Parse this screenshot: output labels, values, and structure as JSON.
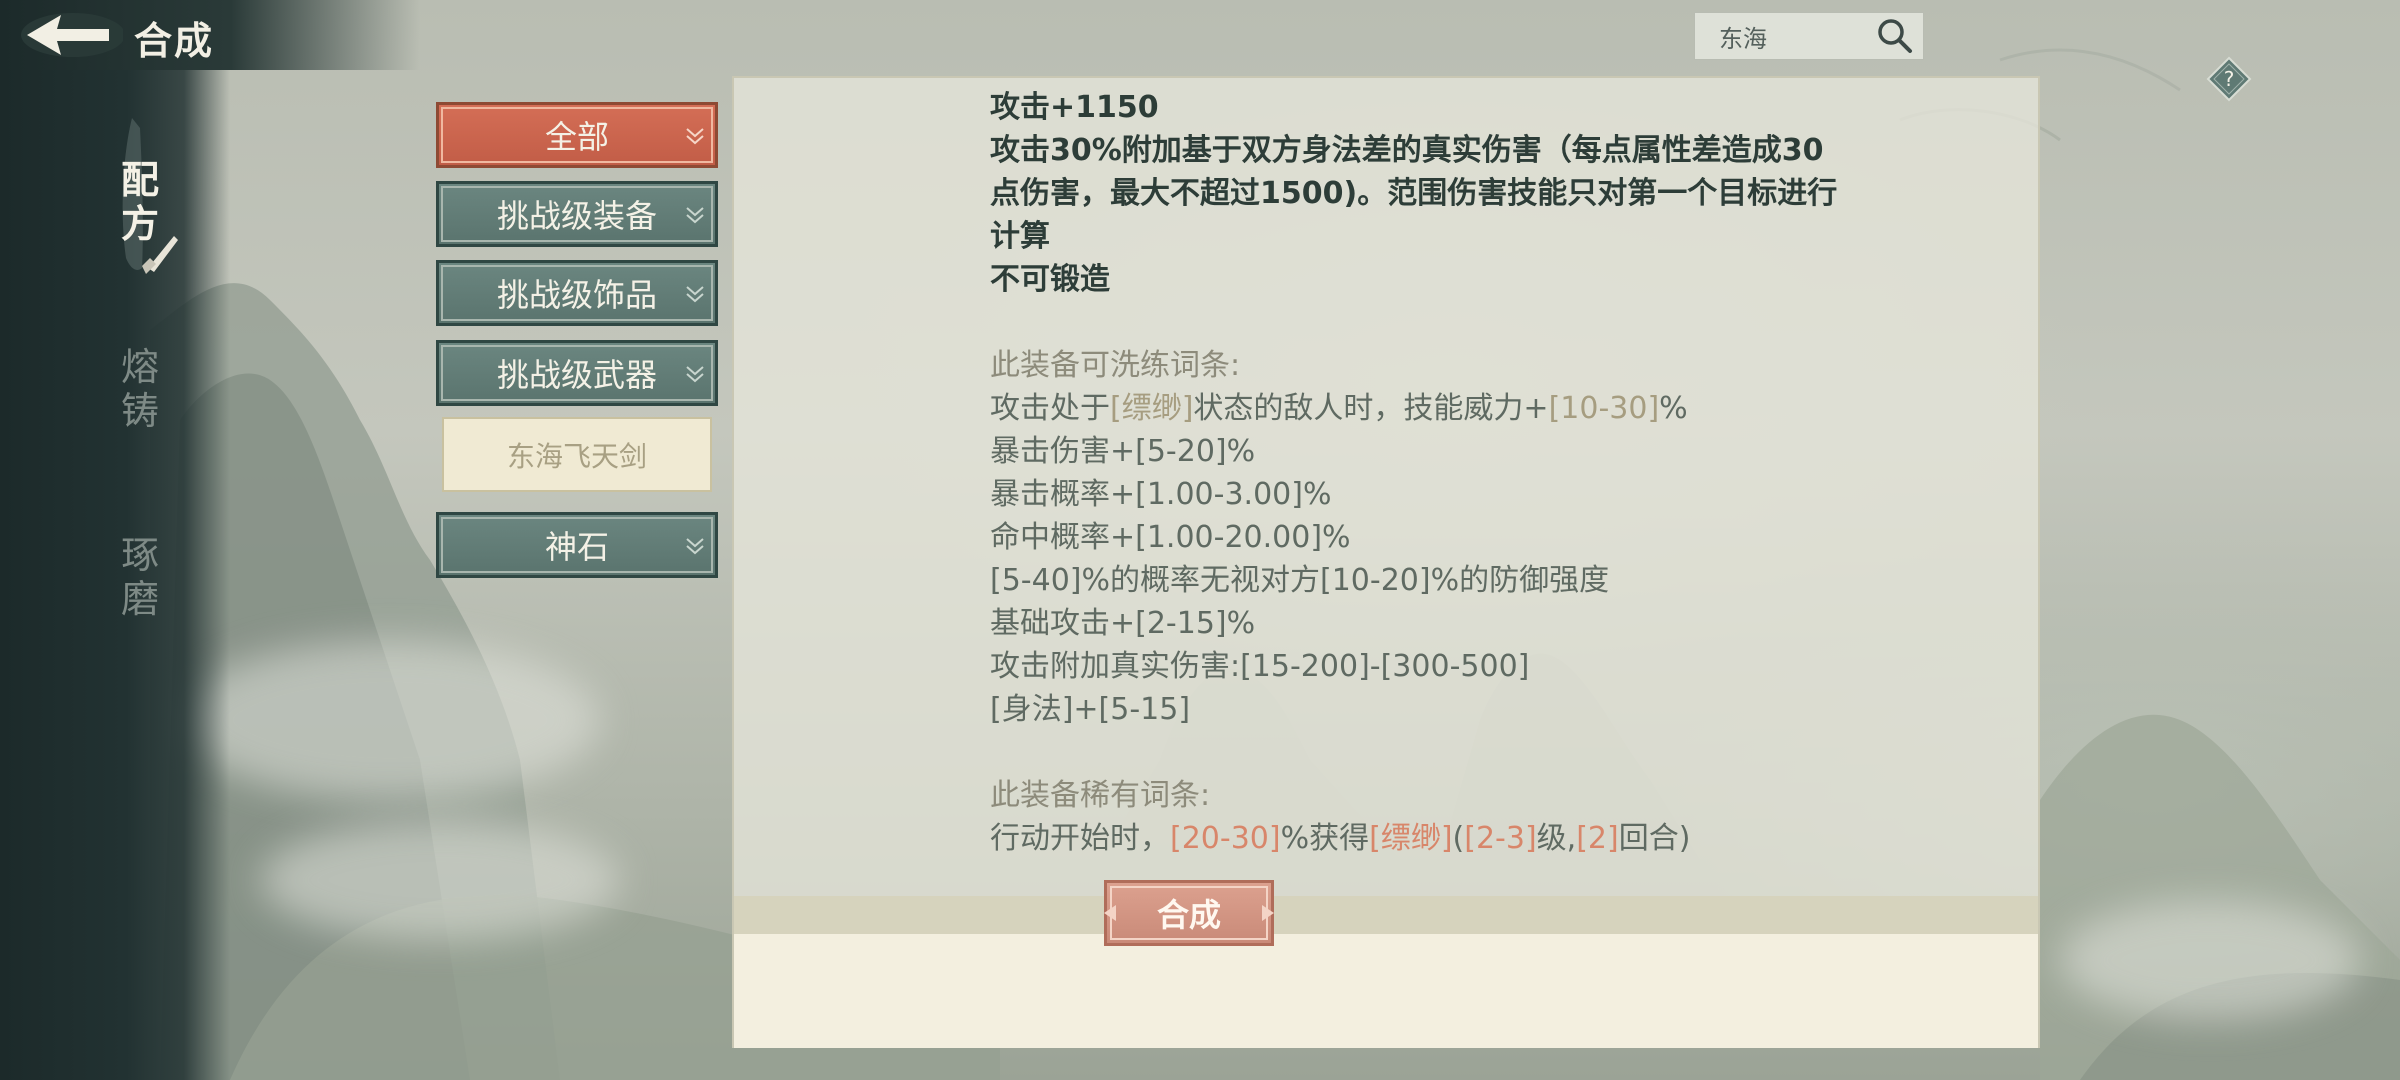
{
  "header": {
    "title": "合成"
  },
  "side_tabs": [
    {
      "label_top": "配",
      "label_bottom": "方",
      "active": true
    },
    {
      "label_top": "熔",
      "label_bottom": "铸",
      "active": false
    },
    {
      "label_top": "琢",
      "label_bottom": "磨",
      "active": false
    }
  ],
  "search": {
    "value": "东海"
  },
  "categories": {
    "all": "全部",
    "equip": "挑战级装备",
    "accessory": "挑战级饰品",
    "weapon": "挑战级武器",
    "selected_item": "东海飞天剑",
    "stone": "神石"
  },
  "colors": {
    "accent_active": "#c9614a",
    "category_bg": "#5e7a74",
    "highlight_text": "#d8866a",
    "panel_bg": "#e6e6da"
  },
  "description": {
    "l1": "攻击+1150",
    "l2": "攻击30%附加基于双方身法差的真实伤害（每点属性差造成30",
    "l3": "点伤害，最大不超过1500)。范围伤害技能只对第一个目标进行",
    "l4": "计算",
    "l5": "不可锻造",
    "refine_heading": "此装备可洗练词条:",
    "r1a": "攻击处于",
    "r1b": "[缥缈]",
    "r1c": "状态的敌人时，技能威力+",
    "r1d": "[10-30]",
    "r1e": "%",
    "r2": "暴击伤害+[5-20]%",
    "r3": "暴击概率+[1.00-3.00]%",
    "r4": "命中概率+[1.00-20.00]%",
    "r5": "[5-40]%的概率无视对方[10-20]%的防御强度",
    "r6": "基础攻击+[2-15]%",
    "r7": "攻击附加真实伤害:[15-200]-[300-500]",
    "r8": "[身法]+[5-15]",
    "rare_heading": "此装备稀有词条:",
    "x1": "行动开始时，",
    "x2": "[20-30]",
    "x3": "%获得",
    "x4": "[缥缈]",
    "x5": "(",
    "x6": "[2-3]",
    "x7": "级,",
    "x8": "[2]",
    "x9": "回合)"
  },
  "footer": {
    "synthesize_label": "合成"
  },
  "icons": [
    "back-arrow-icon",
    "search-icon",
    "help-icon",
    "brush-icon",
    "chevron-down-icon"
  ]
}
